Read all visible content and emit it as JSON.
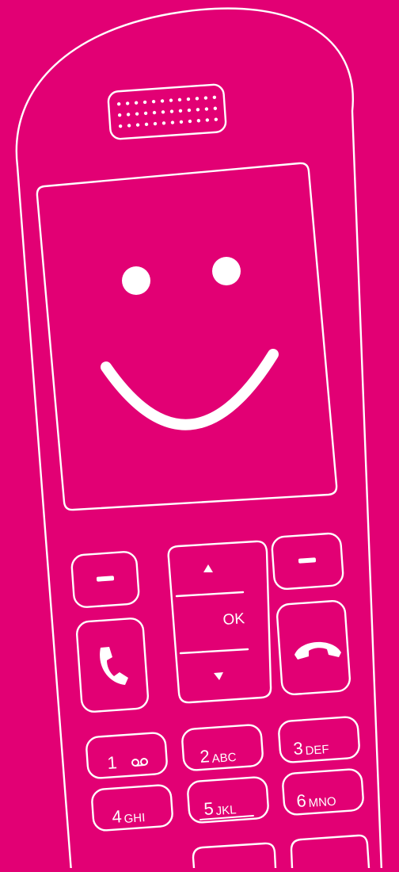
{
  "colors": {
    "background": "#e20074",
    "outline": "#ffffff"
  },
  "handset": {
    "display": {
      "face": "smiley-face"
    },
    "nav": {
      "ok_label": "OK",
      "up_icon": "triangle-up-icon",
      "down_icon": "triangle-down-icon"
    },
    "softkeys": [
      "minus-icon",
      "minus-icon"
    ],
    "call_icon": "phone-handset-icon",
    "end_icon": "hang-up-icon",
    "keys": [
      {
        "digit": "1",
        "letters": "voicemail-icon"
      },
      {
        "digit": "2",
        "letters": "ABC"
      },
      {
        "digit": "3",
        "letters": "DEF"
      },
      {
        "digit": "4",
        "letters": "GHI"
      },
      {
        "digit": "5",
        "letters": "JKL"
      },
      {
        "digit": "6",
        "letters": "MNO"
      }
    ]
  }
}
